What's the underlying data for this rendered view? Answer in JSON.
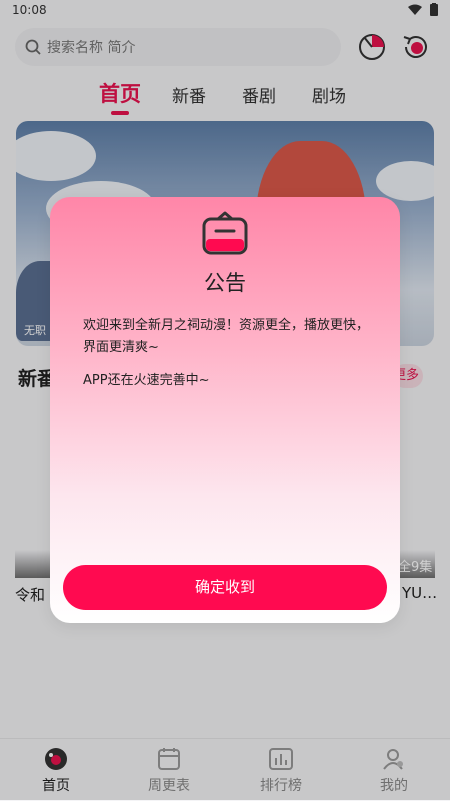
{
  "status": {
    "time": "10:08"
  },
  "search": {
    "placeholder": "搜索名称 简介",
    "icon": "search-icon"
  },
  "header": {
    "icons": [
      "radar-icon",
      "history-icon"
    ]
  },
  "tabs": [
    {
      "label": "首页",
      "active": true
    },
    {
      "label": "新番",
      "active": false
    },
    {
      "label": "番剧",
      "active": false
    },
    {
      "label": "剧场",
      "active": false
    }
  ],
  "banner": {
    "caption": "无职"
  },
  "section": {
    "title": "新番",
    "more": "更多"
  },
  "cards": [
    {
      "name": "令和"
    },
    {
      "name": "YU…",
      "episodes": "全9集"
    }
  ],
  "dialog": {
    "title": "公告",
    "para1": "欢迎来到全新月之祠动漫！资源更全，播放更快，界面更清爽~",
    "para2": "APP还在火速完善中~",
    "confirm": "确定收到"
  },
  "nav": [
    {
      "label": "首页",
      "icon": "home-icon",
      "active": true
    },
    {
      "label": "周更表",
      "icon": "calendar-icon",
      "active": false
    },
    {
      "label": "排行榜",
      "icon": "ranking-icon",
      "active": false
    },
    {
      "label": "我的",
      "icon": "profile-icon",
      "active": false
    }
  ],
  "colors": {
    "accent": "#e8134f",
    "button": "#ff0a50"
  }
}
